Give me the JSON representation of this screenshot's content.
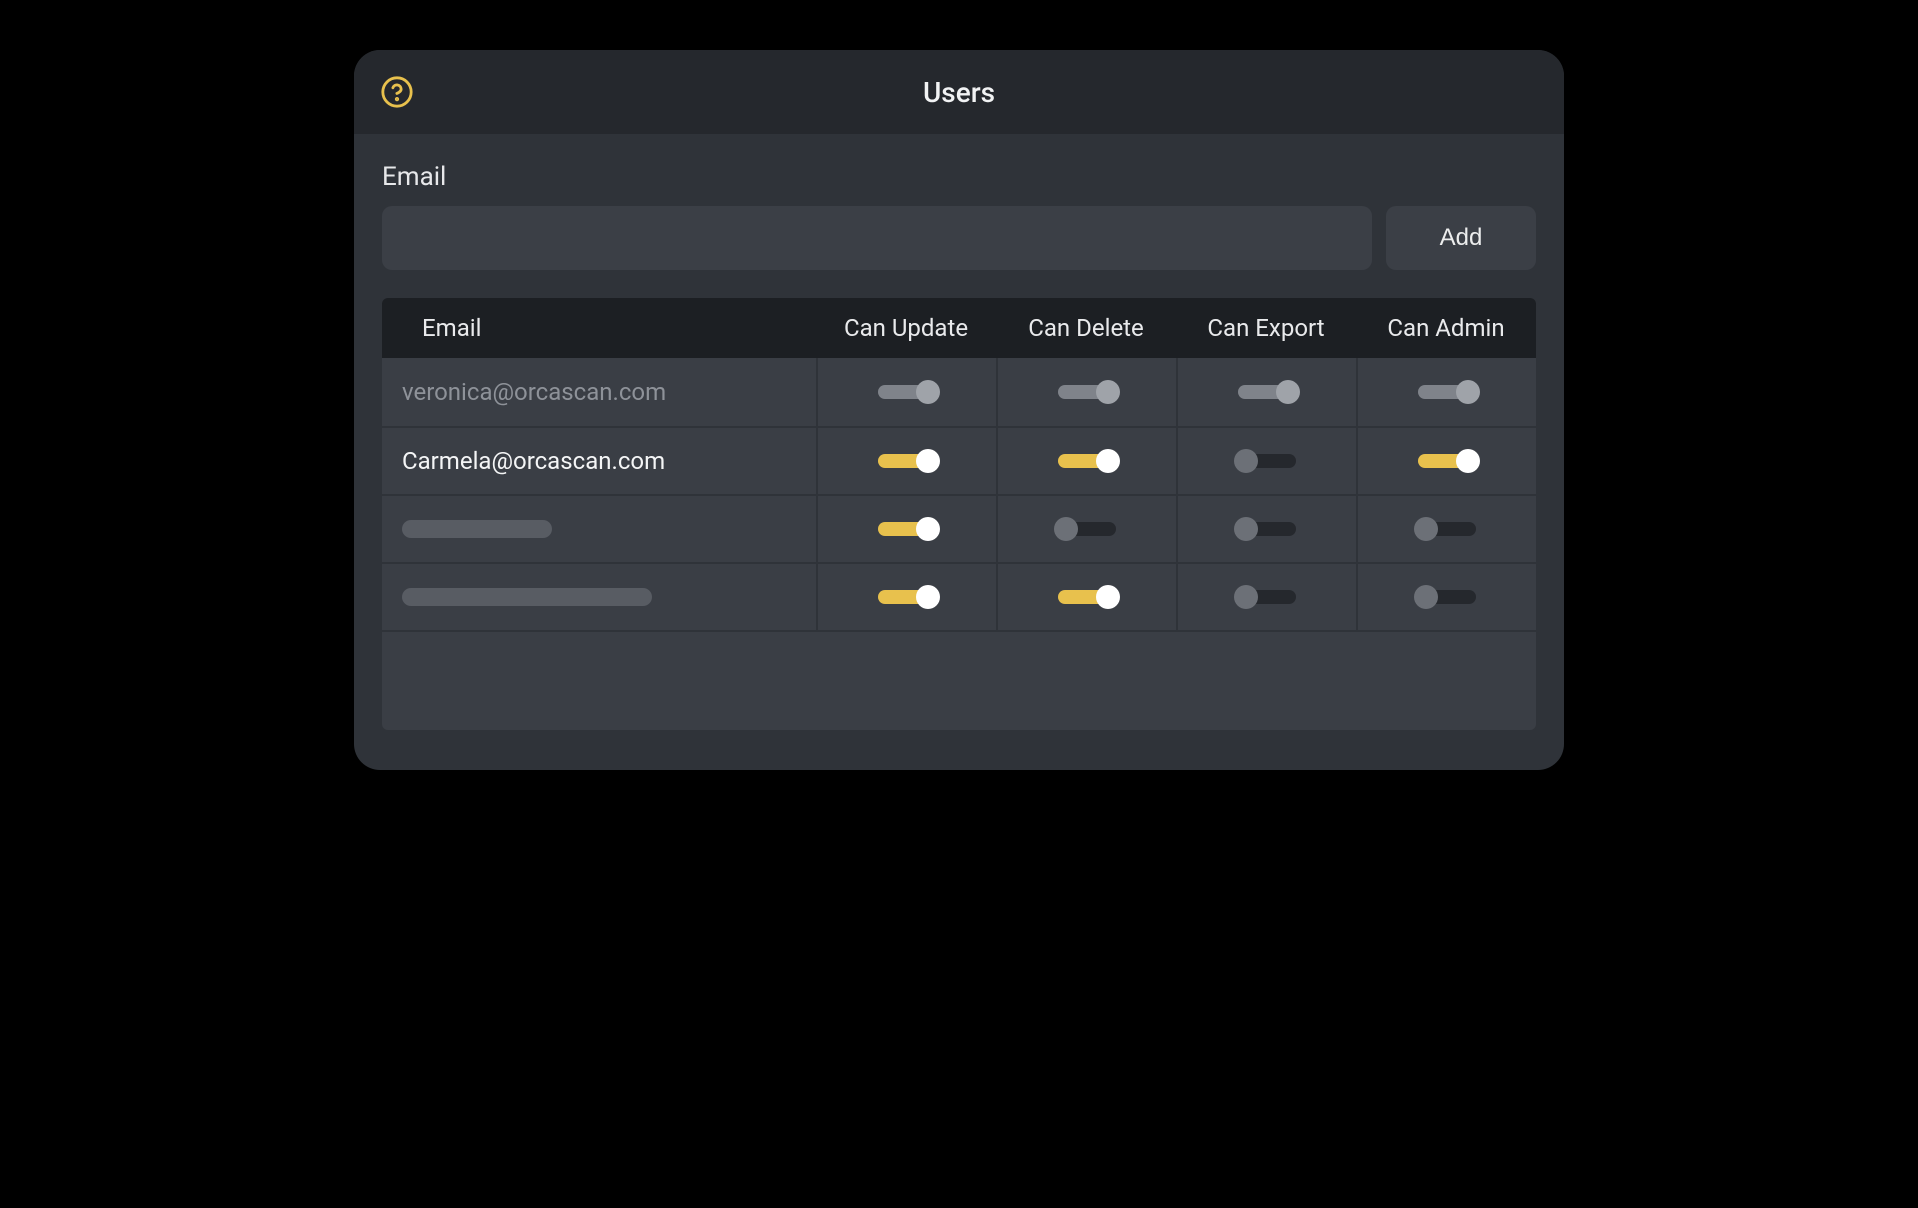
{
  "header": {
    "title": "Users",
    "help_icon": "help-circle"
  },
  "form": {
    "email_label": "Email",
    "email_value": "",
    "add_label": "Add"
  },
  "table": {
    "columns": [
      "Email",
      "Can Update",
      "Can Delete",
      "Can Export",
      "Can Admin"
    ],
    "rows": [
      {
        "email": "veronica@orcascan.com",
        "muted": true,
        "disabled": true,
        "placeholder": false,
        "placeholder_width": 0,
        "can_update": true,
        "can_delete": true,
        "can_export": true,
        "can_admin": true
      },
      {
        "email": "Carmela@orcascan.com",
        "muted": false,
        "disabled": false,
        "placeholder": false,
        "placeholder_width": 0,
        "can_update": true,
        "can_delete": true,
        "can_export": false,
        "can_admin": true
      },
      {
        "email": "",
        "muted": false,
        "disabled": false,
        "placeholder": true,
        "placeholder_width": 150,
        "can_update": true,
        "can_delete": false,
        "can_export": false,
        "can_admin": false
      },
      {
        "email": "",
        "muted": false,
        "disabled": false,
        "placeholder": true,
        "placeholder_width": 250,
        "can_update": true,
        "can_delete": true,
        "can_export": false,
        "can_admin": false
      }
    ]
  },
  "colors": {
    "accent": "#e8c14d",
    "panel_bg": "#2f3339",
    "header_bg": "#25282d",
    "input_bg": "#3b3f46",
    "row_bg": "#3a3e45"
  }
}
